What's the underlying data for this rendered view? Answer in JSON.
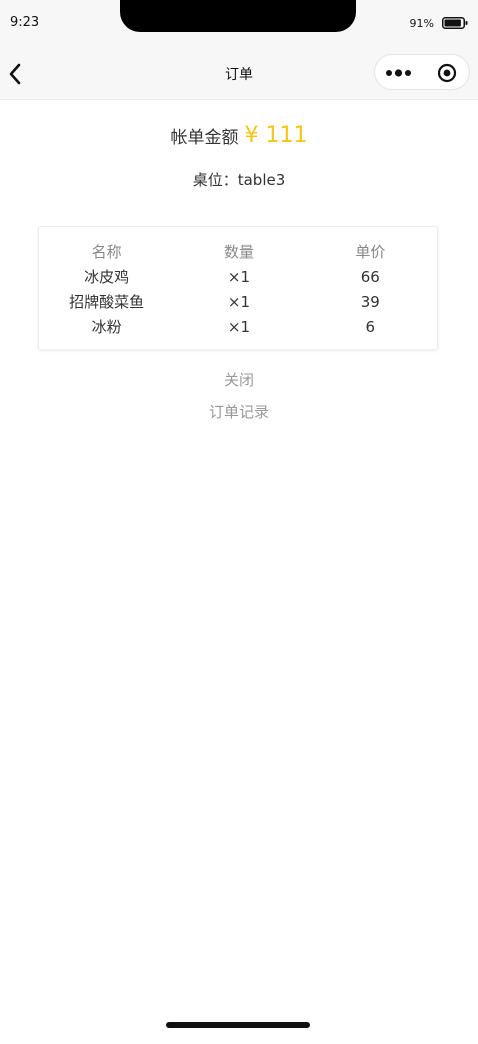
{
  "status_bar": {
    "time": "9:23",
    "battery_percent": "91%",
    "battery_level": 0.91
  },
  "nav": {
    "title": "订单"
  },
  "bill": {
    "label": "帐单金额",
    "amount": "¥ 111"
  },
  "table_info": "桌位：table3",
  "order": {
    "headers": [
      "名称",
      "数量",
      "单价"
    ],
    "rows": [
      {
        "name": "冰皮鸡",
        "qty": "×1",
        "price": "66"
      },
      {
        "name": "招牌酸菜鱼",
        "qty": "×1",
        "price": "39"
      },
      {
        "name": "冰粉",
        "qty": "×1",
        "price": "6"
      }
    ]
  },
  "actions": {
    "close_label": "关闭",
    "history_label": "订单记录"
  },
  "colors": {
    "accent": "#f5c518",
    "nav_background": "#f7f7f7"
  },
  "icons": {
    "back": "chevron-left-icon",
    "more": "more-dots-icon",
    "close": "target-close-icon",
    "battery": "battery-icon"
  }
}
